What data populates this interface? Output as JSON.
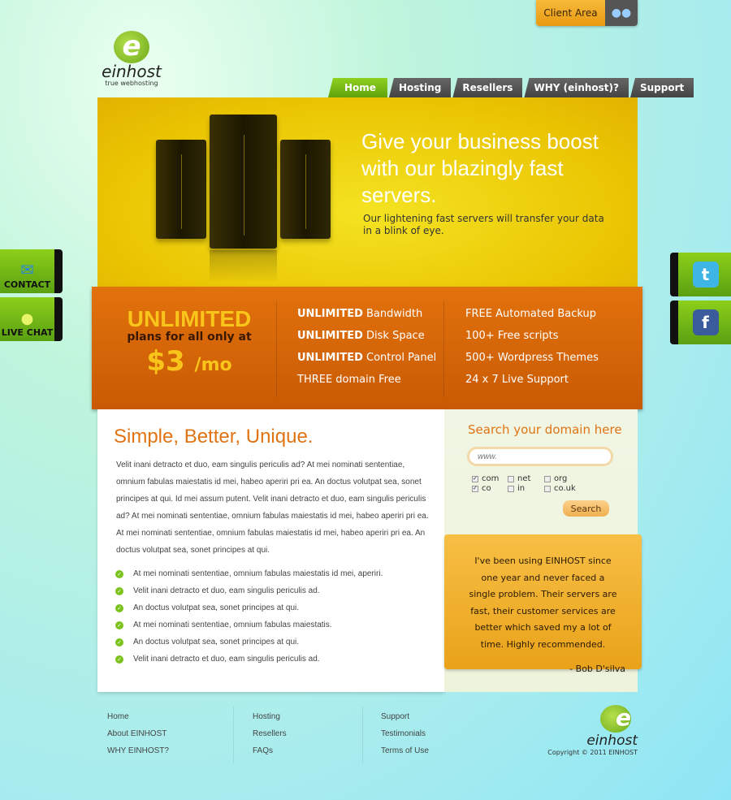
{
  "header": {
    "client_area": "Client Area",
    "client_icon": "users-icon",
    "logo_name": "einhost",
    "logo_letter": "e",
    "logo_tagline": "true webhosting"
  },
  "nav": [
    "Home",
    "Hosting",
    "Resellers",
    "WHY (einhost)?",
    "Support"
  ],
  "hero": {
    "headline": "Give your business boost with our blazingly fast servers.",
    "subtext": "Our lightening fast servers will transfer your data in a blink of eye."
  },
  "promo": {
    "unlimited": "UNLIMITED",
    "plans": "plans for all only at",
    "currency": "$",
    "amount": "3",
    "per": "/mo"
  },
  "features_col1": [
    {
      "bold": "UNLIMITED",
      "text": " Bandwidth"
    },
    {
      "bold": "UNLIMITED",
      "text": " Disk Space"
    },
    {
      "bold": "UNLIMITED",
      "text": " Control Panel"
    },
    {
      "bold": "",
      "text": "THREE domain Free"
    }
  ],
  "features_col2": [
    "FREE Automated Backup",
    "100+ Free scripts",
    "500+ Wordpress Themes",
    "24 x 7 Live Support"
  ],
  "main": {
    "title": "Simple, Better, Unique.",
    "paragraph": "Velit inani detracto et duo, eam singulis periculis ad? At mei nominati sententiae, omnium fabulas maiestatis id mei, habeo aperiri pri ea. An doctus volutpat sea, sonet principes at qui. Id mei assum putent. Velit inani detracto et duo, eam singulis periculis ad? At mei nominati sententiae, omnium fabulas maiestatis id mei, habeo aperiri pri ea. At mei nominati sententiae, omnium fabulas maiestatis id mei, habeo aperiri pri ea. An doctus volutpat sea, sonet principes at qui.",
    "list": [
      "At mei nominati sententiae, omnium fabulas maiestatis id mei, aperiri.",
      "Velit inani detracto et duo, eam singulis periculis ad.",
      "An doctus volutpat sea, sonet principes at qui.",
      "At mei nominati sententiae, omnium fabulas maiestatis.",
      "An doctus volutpat sea, sonet principes at qui.",
      "Velit inani detracto et duo, eam singulis periculis ad."
    ]
  },
  "domain_search": {
    "title": "Search your domain here",
    "placeholder": "www.",
    "button": "Search",
    "options": [
      {
        "label": "com",
        "checked": true
      },
      {
        "label": "net",
        "checked": false
      },
      {
        "label": "org",
        "checked": false
      },
      {
        "label": "co",
        "checked": true
      },
      {
        "label": "in",
        "checked": false
      },
      {
        "label": "co.uk",
        "checked": false
      }
    ]
  },
  "testimonial": {
    "quote": "I've been using EINHOST since one year and never faced a single problem. Their servers are fast, their customer services are better which saved my a lot of time.  Highly recommended.",
    "author": "- Bob D'silva"
  },
  "side_tabs": {
    "contact": "CONTACT",
    "live_chat": "LIVE CHAT",
    "twitter_icon": "t",
    "facebook_icon": "f"
  },
  "footer": {
    "col1": [
      "Home",
      "About EINHOST",
      "WHY EINHOST?"
    ],
    "col2": [
      "Hosting",
      "Resellers",
      "FAQs"
    ],
    "col3": [
      "Support",
      "Testimonials",
      "Terms of Use"
    ],
    "copyright": "Copyright © 2011 EINHOST"
  },
  "colors": {
    "accent_orange": "#e07414",
    "accent_green": "#7cc21c",
    "hero_yellow": "#eac402"
  }
}
